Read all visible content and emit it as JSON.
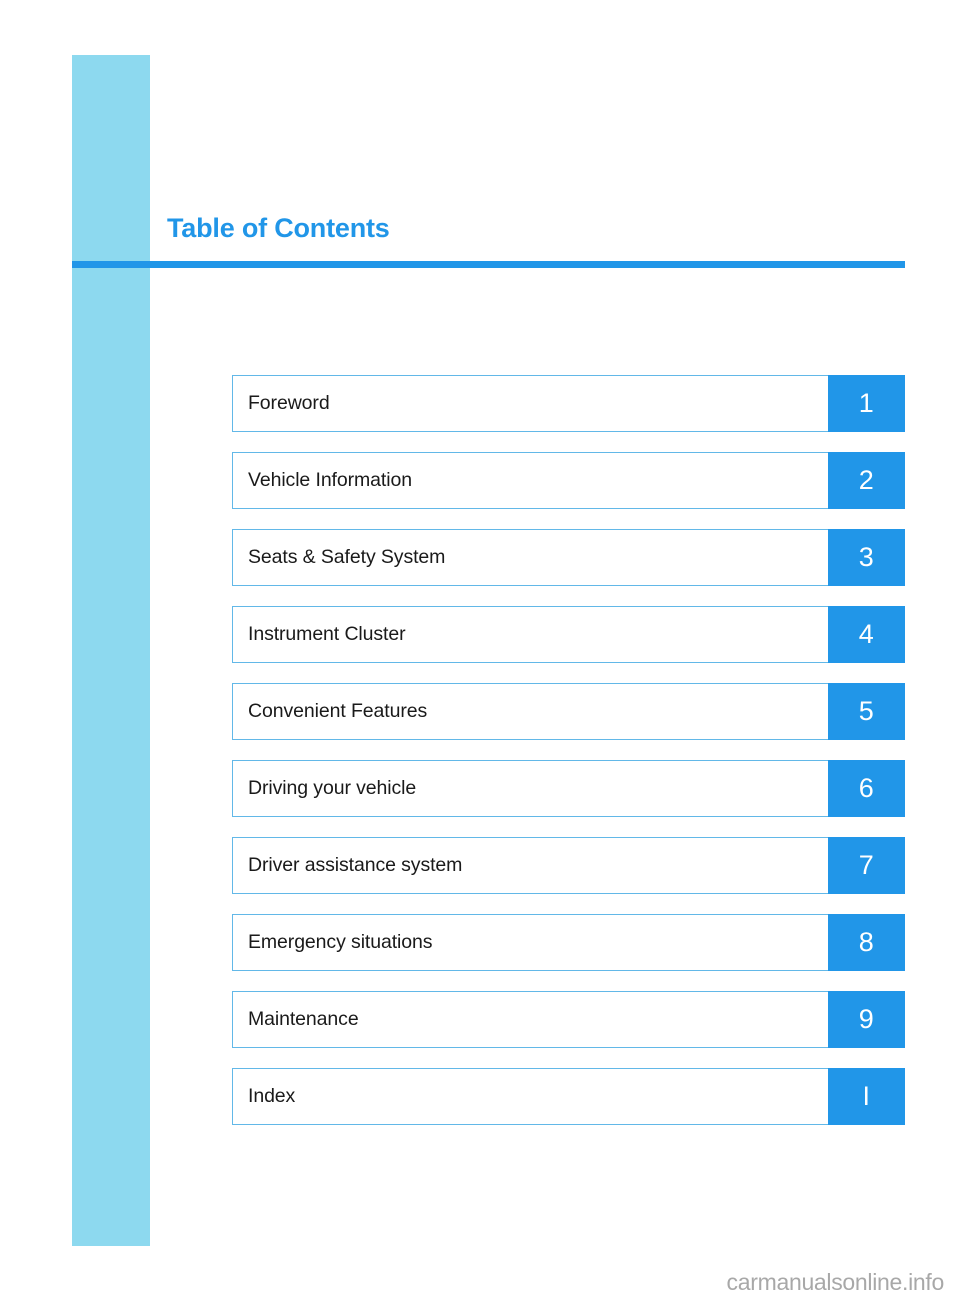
{
  "document": {
    "title": "Table of Contents",
    "watermark": "carmanualsonline.info"
  },
  "colors": {
    "accent_blue": "#2196e8",
    "side_band_blue": "#8dd9ef",
    "row_border_blue": "#62b8e8",
    "label_text": "#1a1a1a",
    "watermark_gray": "#a8a8a8"
  },
  "toc": {
    "entries": [
      {
        "label": "Foreword",
        "marker": "1"
      },
      {
        "label": "Vehicle Information",
        "marker": "2"
      },
      {
        "label": "Seats & Safety System",
        "marker": "3"
      },
      {
        "label": "Instrument Cluster",
        "marker": "4"
      },
      {
        "label": "Convenient Features",
        "marker": "5"
      },
      {
        "label": "Driving your vehicle",
        "marker": "6"
      },
      {
        "label": "Driver assistance system",
        "marker": "7"
      },
      {
        "label": "Emergency situations",
        "marker": "8"
      },
      {
        "label": "Maintenance",
        "marker": "9"
      },
      {
        "label": "Index",
        "marker": "I"
      }
    ]
  }
}
